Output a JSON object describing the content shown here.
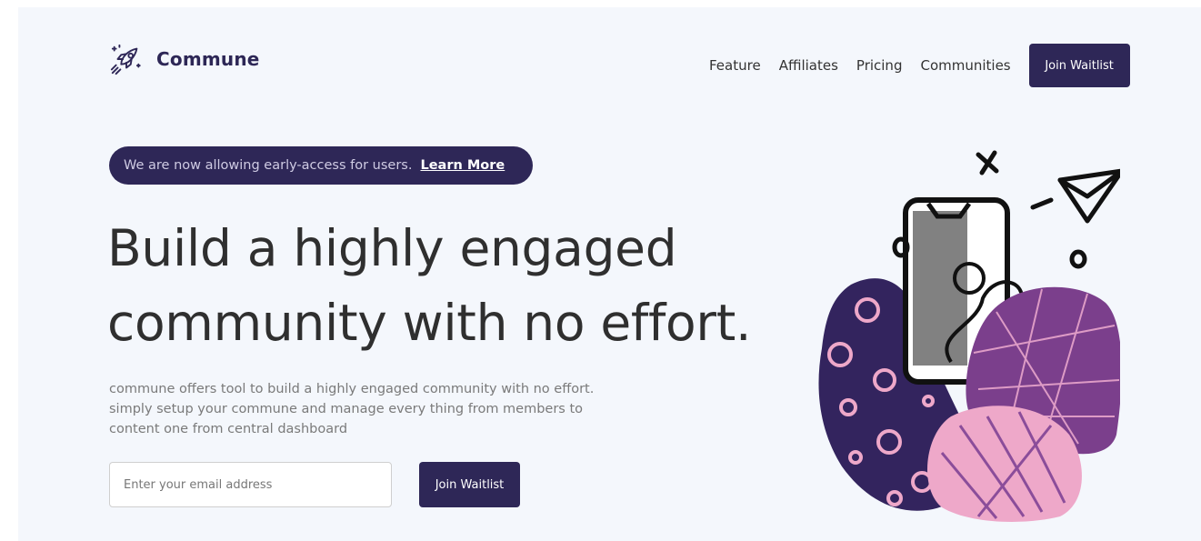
{
  "header": {
    "logo_text": "Commune",
    "logo_icon": "rocket-icon",
    "nav": [
      {
        "label": "Feature"
      },
      {
        "label": "Affiliates"
      },
      {
        "label": "Pricing"
      },
      {
        "label": "Communities"
      }
    ],
    "cta_label": "Join Waitlist"
  },
  "banner": {
    "text": "We are now allowing early-access for users.",
    "link_label": "Learn More"
  },
  "hero": {
    "headline_line1": "Build a highly engaged",
    "headline_line2": "community with no effort.",
    "description": "commune offers tool to build a highly engaged community with no effort. simply setup your commune and manage every thing from members to content one from central dashboard"
  },
  "form": {
    "email_placeholder": "Enter your email address",
    "email_value": "",
    "submit_label": "Join Waitlist"
  },
  "colors": {
    "primary": "#2e2757",
    "background": "#f4f7fc",
    "accent_purple": "#7b3f8c",
    "accent_pink": "#eea8c9"
  }
}
